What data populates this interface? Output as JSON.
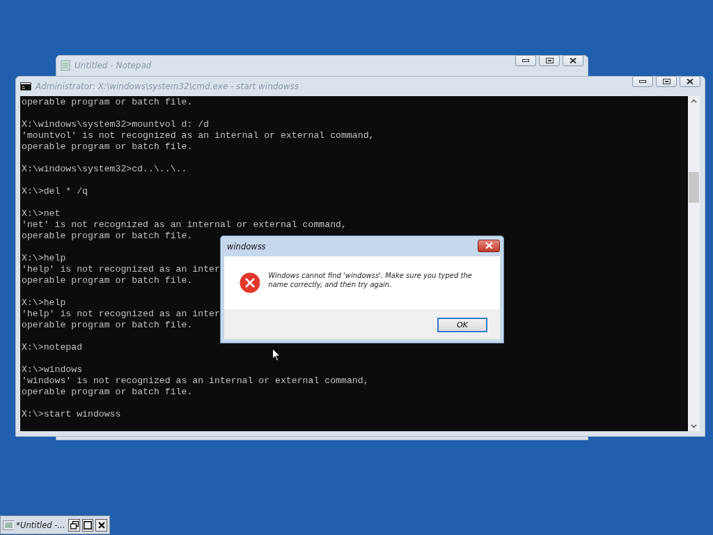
{
  "notepad_window": {
    "title": "Untitled - Notepad"
  },
  "console_window": {
    "title": "Administrator: X:\\windows\\system32\\cmd.exe - start  windowss",
    "blocks": [
      [
        "operable program or batch file."
      ],
      [
        "X:\\windows\\system32>mountvol d: /d",
        "'mountvol' is not recognized as an internal or external command,",
        "operable program or batch file."
      ],
      [
        "X:\\windows\\system32>cd..\\..\\.."
      ],
      [
        "X:\\>del * /q"
      ],
      [
        "X:\\>net",
        "'net' is not recognized as an internal or external command,",
        "operable program or batch file."
      ],
      [
        "X:\\>help",
        "'help' is not recognized as an inter",
        "operable program or batch file."
      ],
      [
        "X:\\>help",
        "'help' is not recognized as an inter",
        "operable program or batch file."
      ],
      [
        "X:\\>notepad"
      ],
      [
        "X:\\>windows",
        "'windows' is not recognized as an internal or external command,",
        "operable program or batch file."
      ],
      [
        "X:\\>start windowss"
      ]
    ]
  },
  "dialog": {
    "title": "windowss",
    "message": "Windows cannot find 'windowss'. Make sure you typed the name correctly, and then try again.",
    "buttons": [
      "OK"
    ]
  },
  "minimized_window": {
    "title": "*Untitled -..."
  }
}
